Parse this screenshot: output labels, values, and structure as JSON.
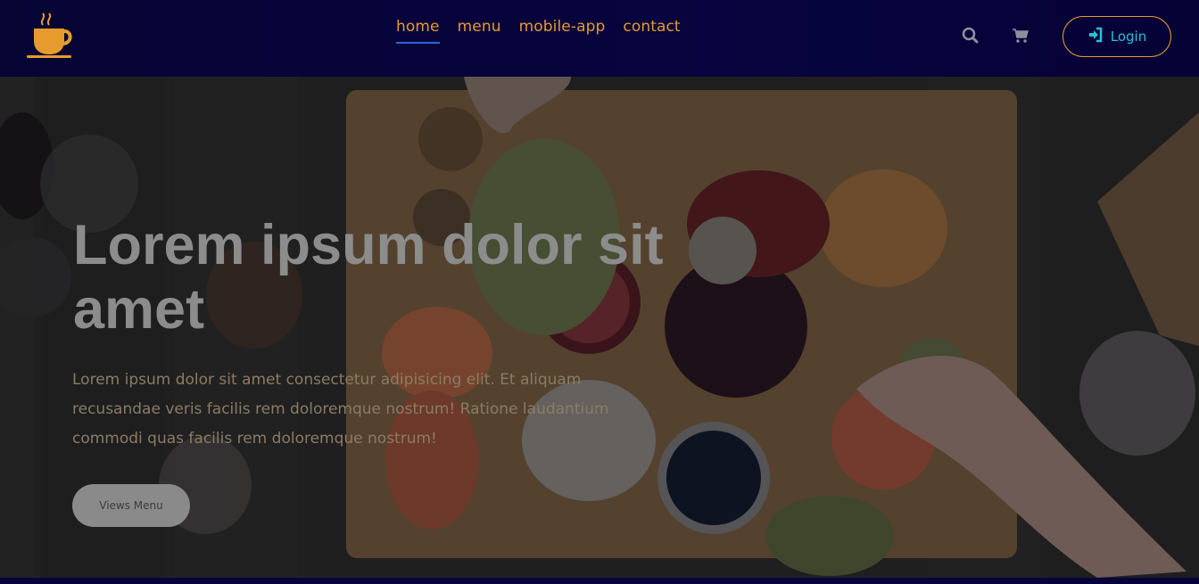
{
  "nav": {
    "links": [
      {
        "label": "home",
        "active": true
      },
      {
        "label": "menu",
        "active": false
      },
      {
        "label": "mobile-app",
        "active": false
      },
      {
        "label": "contact",
        "active": false
      }
    ],
    "icons": [
      "search-icon",
      "cart-icon"
    ],
    "login_label": "Login",
    "login_icon": "sign-in-icon",
    "logo_icon": "coffee-cup-icon"
  },
  "hero": {
    "title": "Lorem ipsum dolor sit amet",
    "text": "Lorem ipsum dolor sit amet consectetur adipisicing elit. Et aliquam recusandae veris facilis rem doloremque nostrum! Ratione laudantium commodi quas facilis rem doloremque nostrum!",
    "button_label": "Views Menu"
  },
  "colors": {
    "nav_bg": "#07043f",
    "accent": "#e69b2c",
    "login_text": "#29c0d6",
    "active_underline": "#2f64d8"
  }
}
